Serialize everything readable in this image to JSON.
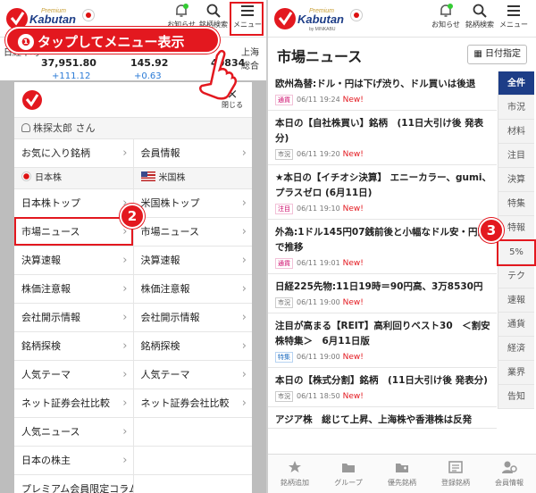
{
  "header": {
    "logo_text": "Kabutan",
    "logo_premium": "Premium",
    "logo_sub": "by MINKABU",
    "notify_label": "お知らせ",
    "search_label": "銘柄検索",
    "menu_label": "メニュー"
  },
  "ticker": {
    "left_label": "日経平均",
    "values": [
      "37,951.80",
      "145.92",
      "40834"
    ],
    "changes": [
      "+111.12",
      "+0.63",
      "+..."
    ],
    "right_label": "上海総合"
  },
  "callout": {
    "num": "❶",
    "text": "タップしてメニュー表示"
  },
  "menu": {
    "close_label": "閉じる",
    "user_name": "株探太郎 さん",
    "top_row": [
      "お気に入り銘柄",
      "会員情報"
    ],
    "sections": [
      "日本株",
      "米国株"
    ],
    "rows": [
      [
        "日本株トップ",
        "米国株トップ"
      ],
      [
        "市場ニュース",
        "市場ニュース"
      ],
      [
        "決算速報",
        "決算速報"
      ],
      [
        "株価注意報",
        "株価注意報"
      ],
      [
        "会社開示情報",
        "会社開示情報"
      ],
      [
        "銘柄探検",
        "銘柄探検"
      ],
      [
        "人気テーマ",
        "人気テーマ"
      ],
      [
        "ネット証券会社比較",
        "ネット証券会社比較"
      ],
      [
        "人気ニュース",
        ""
      ],
      [
        "日本の株主",
        ""
      ],
      [
        "プレミアム会員限定コラム",
        ""
      ]
    ]
  },
  "badges": {
    "two": "2",
    "three": "3"
  },
  "page": {
    "title": "市場ニュース",
    "date_button": "日付指定"
  },
  "news": [
    {
      "title": "欧州為替:ドル・円は下げ渋り、ドル買いは後退",
      "tag": "通貨",
      "tagclass": "t-g",
      "time": "06/11 19:24",
      "new": "New!"
    },
    {
      "title": "本日の【自社株買い】銘柄　(11日大引け後 発表分)",
      "tag": "市況",
      "tagclass": "t-m",
      "time": "06/11 19:20",
      "new": "New!"
    },
    {
      "title": "★本日の【イチオシ決算】 エニーカラー、gumi、プラスゼロ (6月11日)",
      "tag": "注目",
      "tagclass": "t-g",
      "time": "06/11 19:10",
      "new": "New!"
    },
    {
      "title": "外為:1ドル145円07銭前後と小幅なドル安・円高で推移",
      "tag": "通貨",
      "tagclass": "t-g",
      "time": "06/11 19:01",
      "new": "New!"
    },
    {
      "title": "日経225先物:11日19時＝90円高、3万8530円",
      "tag": "市況",
      "tagclass": "t-m",
      "time": "06/11 19:00",
      "new": "New!"
    },
    {
      "title": "注目が高まる【REIT】高利回りベスト30　＜割安株特集＞　6月11日版",
      "tag": "特集",
      "tagclass": "t-s",
      "time": "06/11 19:00",
      "new": "New!"
    },
    {
      "title": "本日の【株式分割】銘柄　(11日大引け後 発表分)",
      "tag": "市況",
      "tagclass": "t-m",
      "time": "06/11 18:50",
      "new": "New!"
    },
    {
      "title": "アジア株　総じて上昇、上海株や香港株は反発",
      "tag": "",
      "tagclass": "t-m",
      "time": "",
      "new": ""
    }
  ],
  "tabs": [
    "全件",
    "市況",
    "材料",
    "注目",
    "決算",
    "特集",
    "特報",
    "5%",
    "テク",
    "速報",
    "通貨",
    "経済",
    "業界",
    "告知"
  ],
  "bottom_nav": [
    "銘柄追加",
    "グループ",
    "優先銘柄",
    "登録銘柄",
    "会員情報"
  ],
  "colors": {
    "accent": "#e3181f",
    "navy": "#1d3d87"
  }
}
